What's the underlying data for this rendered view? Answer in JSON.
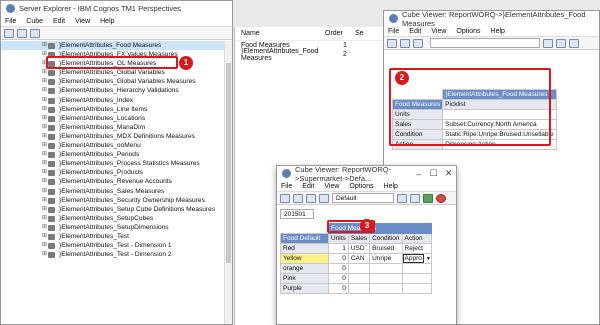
{
  "server_explorer": {
    "title": "Server Explorer - IBM Cognos TM1 Perspectives",
    "menu": [
      "File",
      "Cube",
      "Edit",
      "View",
      "Help"
    ],
    "tree_items": [
      "}ElementAttributes_Food Measures",
      "}ElementAttributes_FX Values Measures",
      "}ElementAttributes_GL Measures",
      "}ElementAttributes_Global Variables",
      "}ElementAttributes_Global Variables Measures",
      "}ElementAttributes_Hierarchy Validations",
      "}ElementAttributes_Index",
      "}ElementAttributes_Line Items",
      "}ElementAttributes_Locations",
      "}ElementAttributes_MariaDim",
      "}ElementAttributes_MDX Definitions Measures",
      "}ElementAttributes_ooMenu",
      "}ElementAttributes_Periods",
      "}ElementAttributes_Process Statistics Measures",
      "}ElementAttributes_Products",
      "}ElementAttributes_Revenue Accounts",
      "}ElementAttributes_Sales Measures",
      "}ElementAttributes_Security Ownership Measures",
      "}ElementAttributes_Setup Cube Definitions Measures",
      "}ElementAttributes_SetupCubes",
      "}ElementAttributes_SetupDimensions",
      "}ElementAttributes_Test",
      "}ElementAttributes_Test - Dimension 1",
      "}ElementAttributes_Test - Dimension 2"
    ]
  },
  "pane": {
    "col_name": "Name",
    "col_order": "Order",
    "col_se": "Se",
    "rows": [
      {
        "name": "Food Measures",
        "order": "1"
      },
      {
        "name": "}ElementAttributes_Food Measures",
        "order": "2"
      }
    ]
  },
  "cube_viewer_top": {
    "title": "Cube Viewer: ReportWORQ->}ElementAttributes_Food Measures",
    "menu": [
      "File",
      "Edit",
      "View",
      "Options",
      "Help"
    ],
    "col_header": "}ElementAttributes_Food Measures",
    "row_header": "Food Measures",
    "col_label": "Picklist",
    "rows": [
      {
        "label": "Units",
        "value": ""
      },
      {
        "label": "Sales",
        "value": "Subset:Currency:North America"
      },
      {
        "label": "Condition",
        "value": "Static:Ripe:Unripe:Bruised:Unsellable"
      },
      {
        "label": "Action",
        "value": "Dimension:Action"
      }
    ]
  },
  "cube_viewer_bottom": {
    "title": "Cube Viewer: ReportWORQ->Supermarket->Defa...",
    "menu": [
      "File",
      "Edit",
      "View",
      "Options",
      "Help"
    ],
    "view_select": "Default",
    "period": "201501",
    "col_dim": "Food Measures",
    "row_dim": "Food Default",
    "columns": [
      "Units",
      "Sales",
      "Condition",
      "Action"
    ],
    "rows": [
      {
        "label": "Red",
        "units": "1",
        "sales": "USD",
        "condition": "Bruised",
        "action": "Reject"
      },
      {
        "label": "Yellow",
        "units": "0",
        "sales": "CAN",
        "condition": "Unripe",
        "action": "Appro"
      },
      {
        "label": "orange",
        "units": "0",
        "sales": "",
        "condition": "",
        "action": ""
      },
      {
        "label": "Pink",
        "units": "0",
        "sales": "",
        "condition": "",
        "action": ""
      },
      {
        "label": "Purple",
        "units": "0",
        "sales": "",
        "condition": "",
        "action": ""
      }
    ]
  },
  "badges": [
    "1",
    "2",
    "3"
  ],
  "colors": {
    "highlight_red": "#d6191f",
    "dim_header_blue": "#6b8cc7",
    "yellow_row": "#fff38a"
  }
}
